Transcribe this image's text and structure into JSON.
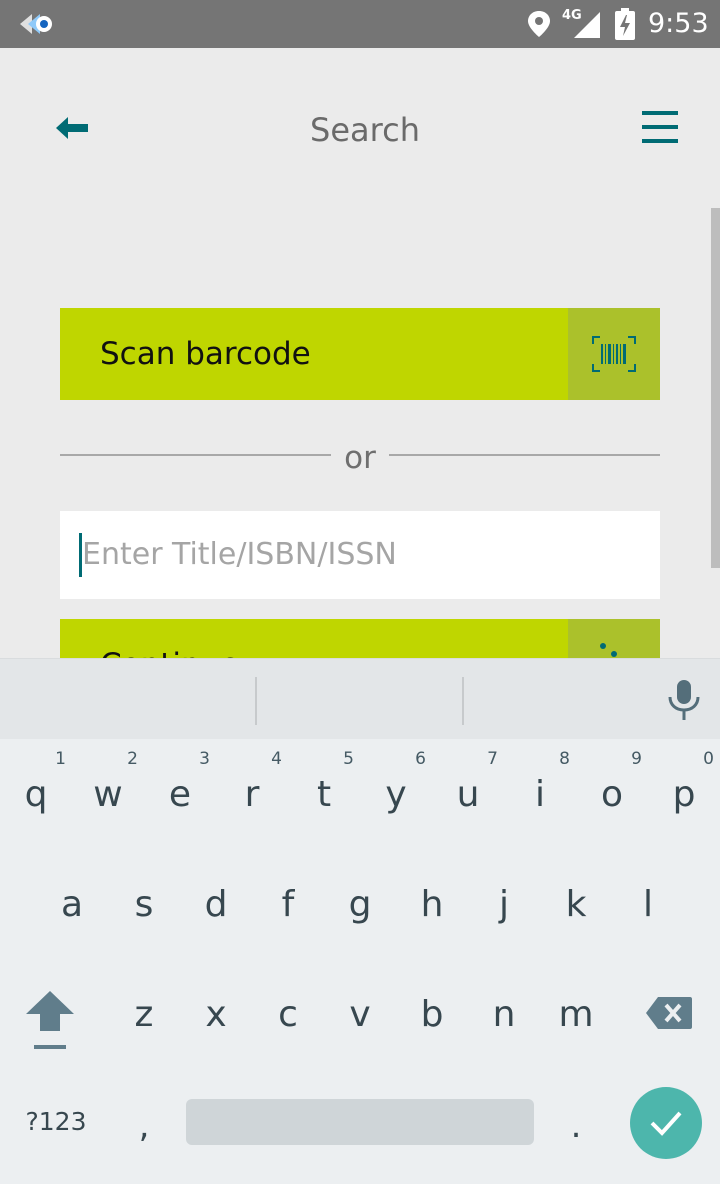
{
  "status_bar": {
    "network_label": "4G",
    "time": "9:53",
    "icons": [
      "app-notification-icon",
      "location-icon",
      "signal-icon",
      "battery-charging-icon"
    ]
  },
  "app_bar": {
    "title": "Search",
    "back_icon": "arrow-left-icon",
    "menu_icon": "hamburger-menu-icon",
    "accent_color": "#006b74"
  },
  "main": {
    "scan_button_label": "Scan barcode",
    "scan_icon": "barcode-scan-icon",
    "divider_text": "or",
    "search": {
      "placeholder": "Enter Title/ISBN/ISSN",
      "value": ""
    },
    "continue_button_label": "Continue",
    "button_color": "#bfd600",
    "button_icon_bg": "#abc12b"
  },
  "keyboard": {
    "row1": [
      {
        "key": "q",
        "hint": "1"
      },
      {
        "key": "w",
        "hint": "2"
      },
      {
        "key": "e",
        "hint": "3"
      },
      {
        "key": "r",
        "hint": "4"
      },
      {
        "key": "t",
        "hint": "5"
      },
      {
        "key": "y",
        "hint": "6"
      },
      {
        "key": "u",
        "hint": "7"
      },
      {
        "key": "i",
        "hint": "8"
      },
      {
        "key": "o",
        "hint": "9"
      },
      {
        "key": "p",
        "hint": "0"
      }
    ],
    "row2": [
      "a",
      "s",
      "d",
      "f",
      "g",
      "h",
      "j",
      "k",
      "l"
    ],
    "row3": [
      "z",
      "x",
      "c",
      "v",
      "b",
      "n",
      "m"
    ],
    "symbols_label": "?123",
    "comma": ",",
    "period": ".",
    "enter_icon": "checkmark-icon",
    "enter_color": "#4db6ac"
  }
}
